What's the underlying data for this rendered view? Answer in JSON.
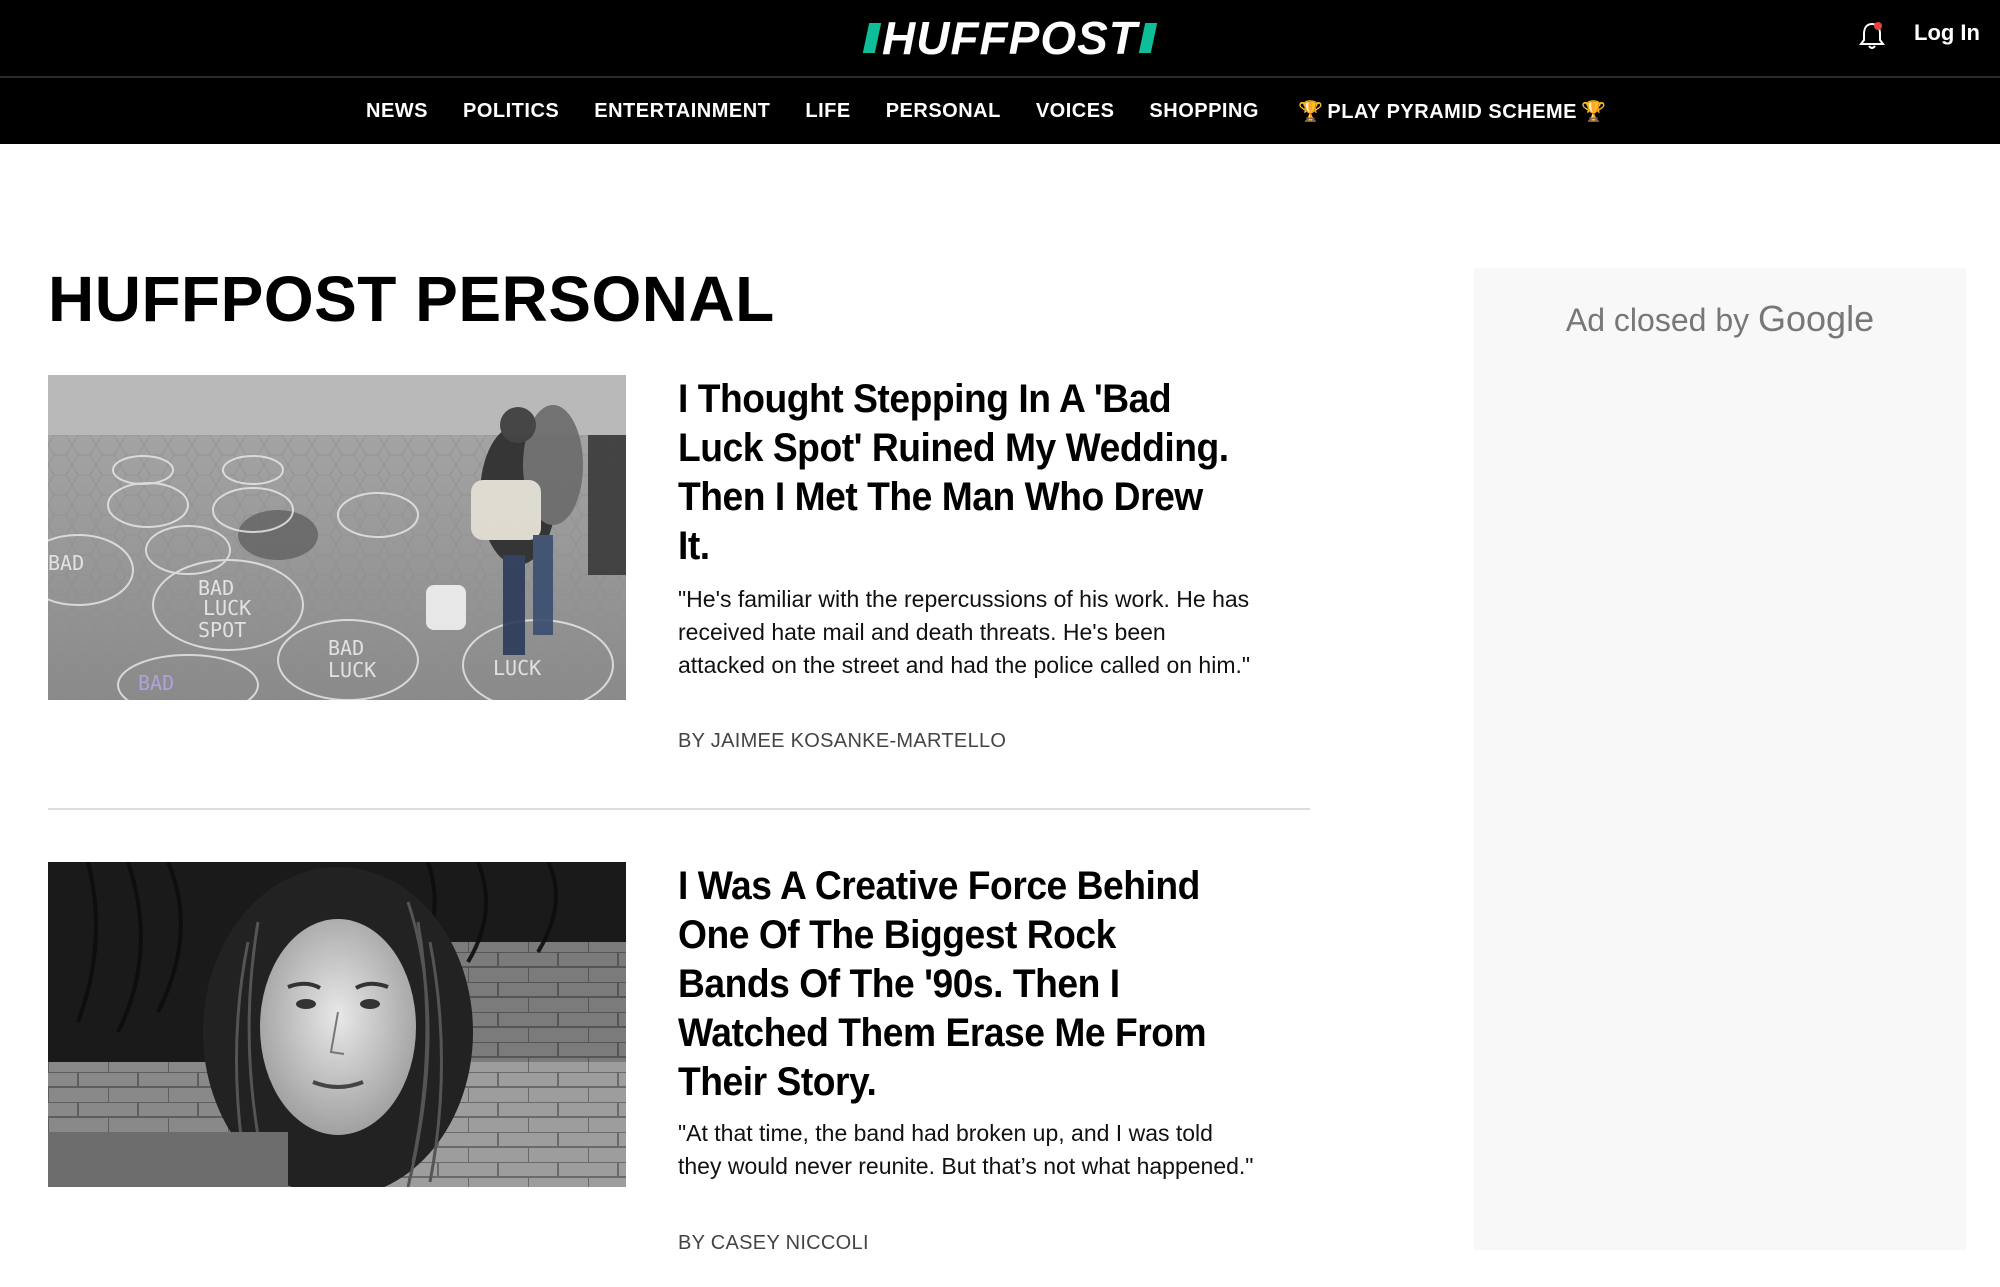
{
  "header": {
    "logo_text": "HUFFPOST",
    "login_label": "Log In",
    "icons": {
      "notification": "bell-icon"
    }
  },
  "nav": {
    "items": [
      "NEWS",
      "POLITICS",
      "ENTERTAINMENT",
      "LIFE",
      "PERSONAL",
      "VOICES",
      "SHOPPING"
    ],
    "special": {
      "label": "PLAY PYRAMID SCHEME",
      "icon": "trophy-icon"
    }
  },
  "page": {
    "title": "HUFFPOST PERSONAL"
  },
  "articles": [
    {
      "headline": "I Thought Stepping In A 'Bad Luck Spot' Ruined My Wedding. Then I Met The Man Who Drew It.",
      "summary": "\"He's familiar with the repercussions of his work. He has received hate mail and death threats. He's been attacked on the street and had the police called on him.\"",
      "byline": "BY JAIMEE KOSANKE-MARTELLO",
      "image": {
        "chalk_labels": [
          "BAD",
          "LUCK",
          "SPOT"
        ]
      }
    },
    {
      "headline": "I Was A Creative Force Behind One Of The Biggest Rock Bands Of The '90s. Then I Watched Them Erase Me From Their Story.",
      "summary": "\"At that time, the band had broken up, and I was told they would never reunite. But that’s not what happened.\"",
      "byline": "BY CASEY NICCOLI"
    }
  ],
  "ad": {
    "text": "Ad closed by",
    "brand": "Google"
  },
  "colors": {
    "accent": "#0dbe98",
    "nav_bg": "#000000",
    "trophy": "#d4a017"
  }
}
